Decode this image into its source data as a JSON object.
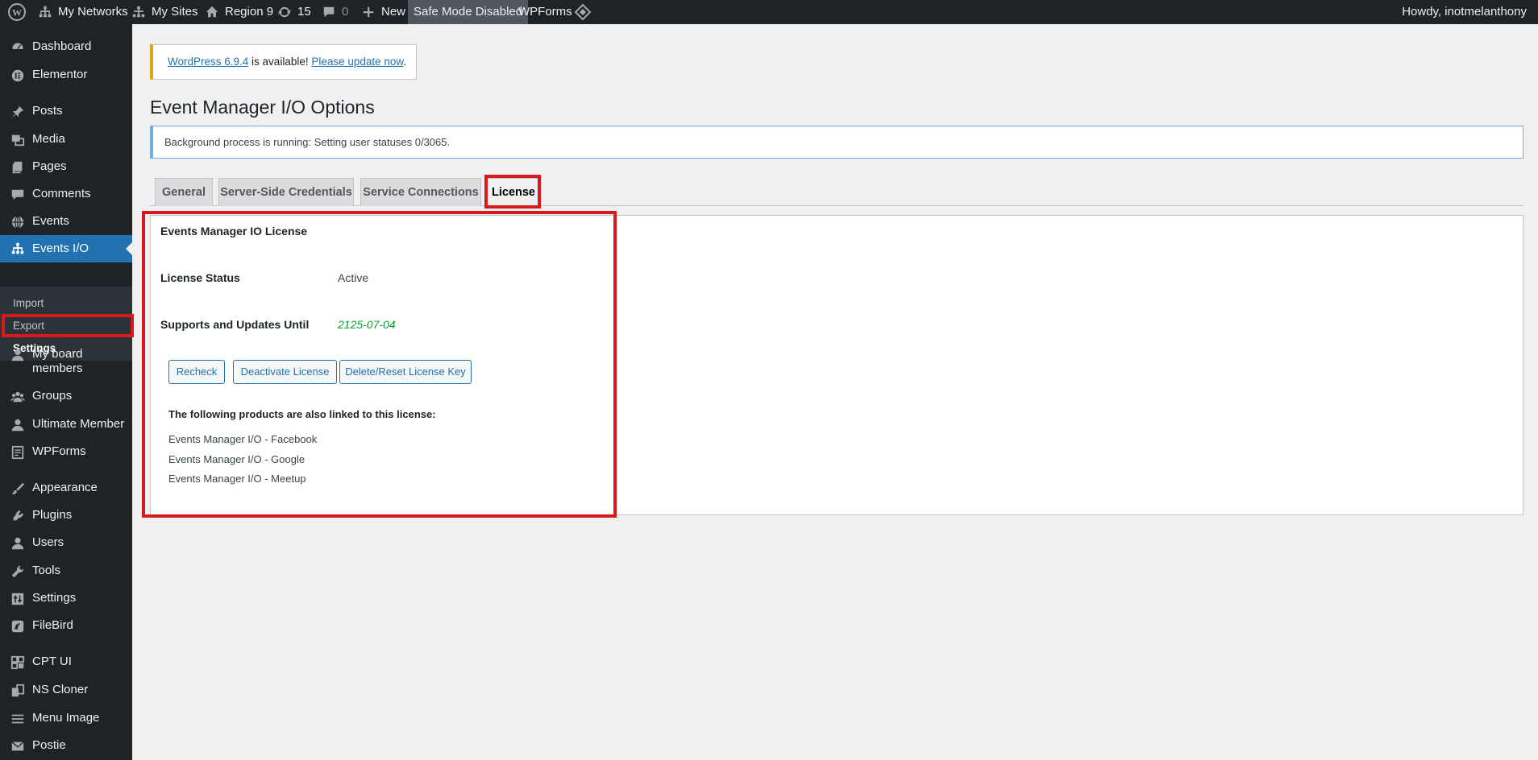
{
  "admin_bar": {
    "my_networks": "My Networks",
    "my_sites": "My Sites",
    "site_name": "Region 9",
    "updates_count": "15",
    "comments_count": "0",
    "new_label": "New",
    "safe_mode": "Safe Mode Disabled",
    "wpforms": "WPForms",
    "howdy": "Howdy, inotmelanthony"
  },
  "sidebar": {
    "items": [
      {
        "label": "Dashboard",
        "icon": "dashboard-icon"
      },
      {
        "label": "Elementor",
        "icon": "elementor-icon"
      },
      {
        "label": "Posts",
        "icon": "pin-icon"
      },
      {
        "label": "Media",
        "icon": "media-icon"
      },
      {
        "label": "Pages",
        "icon": "pages-icon"
      },
      {
        "label": "Comments",
        "icon": "comment-icon"
      },
      {
        "label": "Events",
        "icon": "globe-icon"
      },
      {
        "label": "Events I/O",
        "icon": "network-icon"
      },
      {
        "label": "My board",
        "label2": "members",
        "icon": "user-icon"
      },
      {
        "label": "Groups",
        "icon": "groups-icon"
      },
      {
        "label": "Ultimate Member",
        "icon": "user-icon"
      },
      {
        "label": "WPForms",
        "icon": "form-icon"
      },
      {
        "label": "Appearance",
        "icon": "brush-icon"
      },
      {
        "label": "Plugins",
        "icon": "plugin-icon"
      },
      {
        "label": "Users",
        "icon": "user-icon"
      },
      {
        "label": "Tools",
        "icon": "wrench-icon"
      },
      {
        "label": "Settings",
        "icon": "settings-icon"
      },
      {
        "label": "FileBird",
        "icon": "filebird-icon"
      },
      {
        "label": "CPT UI",
        "icon": "grid-icon"
      },
      {
        "label": "NS Cloner",
        "icon": "clone-icon"
      },
      {
        "label": "Menu Image",
        "icon": "menu-icon"
      },
      {
        "label": "Postie",
        "icon": "mail-icon"
      }
    ],
    "submenu": [
      "Import",
      "Export",
      "Settings"
    ]
  },
  "notice_update": {
    "link1": "WordPress 6.9.4",
    "text": " is available! ",
    "link2": "Please update now",
    "end": "."
  },
  "page_title": "Event Manager I/O Options",
  "notice_info": "Background process is running: Setting user statuses 0/3065.",
  "tabs": [
    "General",
    "Server-Side Credentials",
    "Service Connections",
    "License"
  ],
  "license": {
    "heading": "Events Manager IO License",
    "status_label": "License Status",
    "status_value": "Active",
    "until_label": "Supports and Updates Until",
    "until_value": "2125-07-04",
    "buttons": [
      "Recheck",
      "Deactivate License",
      "Delete/Reset License Key"
    ],
    "linked_intro": "The following products are also linked to this license:",
    "linked_products": [
      "Events Manager I/O - Facebook",
      "Events Manager I/O - Google",
      "Events Manager I/O - Meetup"
    ]
  },
  "colors": {
    "highlight": "#d7191c",
    "accent": "#2271b1",
    "date_green": "#00a32a"
  }
}
